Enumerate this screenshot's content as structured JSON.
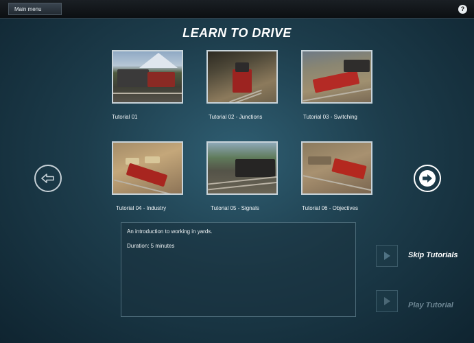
{
  "topbar": {
    "menu_label": "Main menu",
    "help_glyph": "?"
  },
  "title": "LEARN TO DRIVE",
  "tutorials": [
    {
      "label": "Tutorial 01"
    },
    {
      "label": "Tutorial 02 - Junctions"
    },
    {
      "label": "Tutorial 03 - Switching"
    },
    {
      "label": "Tutorial 04 - Industry"
    },
    {
      "label": "Tutorial 05 - Signals"
    },
    {
      "label": "Tutorial 06 - Objectives"
    }
  ],
  "description": {
    "text": "An introduction to working in yards.",
    "duration": "Duration: 5 minutes"
  },
  "actions": {
    "skip_label": "Skip Tutorials",
    "play_label": "Play Tutorial"
  },
  "colors": {
    "skip_active": "#ffffff",
    "play_disabled": "#6e8794"
  }
}
